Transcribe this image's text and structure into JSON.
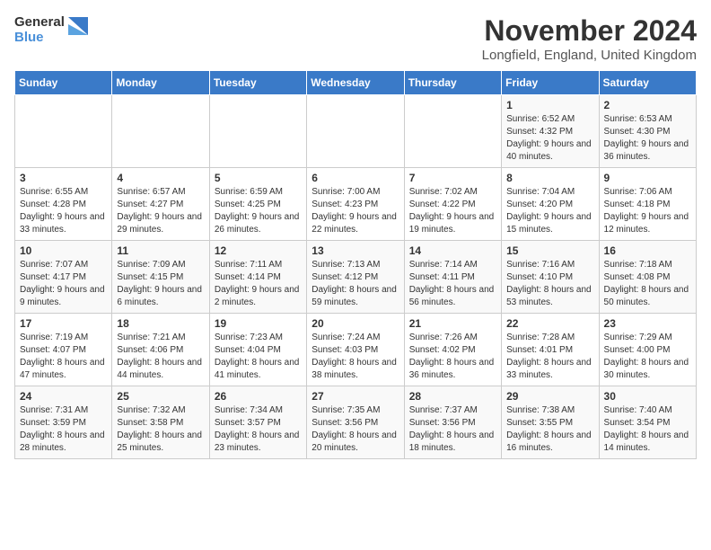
{
  "header": {
    "logo_general": "General",
    "logo_blue": "Blue",
    "month_title": "November 2024",
    "location": "Longfield, England, United Kingdom"
  },
  "days_of_week": [
    "Sunday",
    "Monday",
    "Tuesday",
    "Wednesday",
    "Thursday",
    "Friday",
    "Saturday"
  ],
  "weeks": [
    [
      {
        "day": "",
        "info": ""
      },
      {
        "day": "",
        "info": ""
      },
      {
        "day": "",
        "info": ""
      },
      {
        "day": "",
        "info": ""
      },
      {
        "day": "",
        "info": ""
      },
      {
        "day": "1",
        "info": "Sunrise: 6:52 AM\nSunset: 4:32 PM\nDaylight: 9 hours and 40 minutes."
      },
      {
        "day": "2",
        "info": "Sunrise: 6:53 AM\nSunset: 4:30 PM\nDaylight: 9 hours and 36 minutes."
      }
    ],
    [
      {
        "day": "3",
        "info": "Sunrise: 6:55 AM\nSunset: 4:28 PM\nDaylight: 9 hours and 33 minutes."
      },
      {
        "day": "4",
        "info": "Sunrise: 6:57 AM\nSunset: 4:27 PM\nDaylight: 9 hours and 29 minutes."
      },
      {
        "day": "5",
        "info": "Sunrise: 6:59 AM\nSunset: 4:25 PM\nDaylight: 9 hours and 26 minutes."
      },
      {
        "day": "6",
        "info": "Sunrise: 7:00 AM\nSunset: 4:23 PM\nDaylight: 9 hours and 22 minutes."
      },
      {
        "day": "7",
        "info": "Sunrise: 7:02 AM\nSunset: 4:22 PM\nDaylight: 9 hours and 19 minutes."
      },
      {
        "day": "8",
        "info": "Sunrise: 7:04 AM\nSunset: 4:20 PM\nDaylight: 9 hours and 15 minutes."
      },
      {
        "day": "9",
        "info": "Sunrise: 7:06 AM\nSunset: 4:18 PM\nDaylight: 9 hours and 12 minutes."
      }
    ],
    [
      {
        "day": "10",
        "info": "Sunrise: 7:07 AM\nSunset: 4:17 PM\nDaylight: 9 hours and 9 minutes."
      },
      {
        "day": "11",
        "info": "Sunrise: 7:09 AM\nSunset: 4:15 PM\nDaylight: 9 hours and 6 minutes."
      },
      {
        "day": "12",
        "info": "Sunrise: 7:11 AM\nSunset: 4:14 PM\nDaylight: 9 hours and 2 minutes."
      },
      {
        "day": "13",
        "info": "Sunrise: 7:13 AM\nSunset: 4:12 PM\nDaylight: 8 hours and 59 minutes."
      },
      {
        "day": "14",
        "info": "Sunrise: 7:14 AM\nSunset: 4:11 PM\nDaylight: 8 hours and 56 minutes."
      },
      {
        "day": "15",
        "info": "Sunrise: 7:16 AM\nSunset: 4:10 PM\nDaylight: 8 hours and 53 minutes."
      },
      {
        "day": "16",
        "info": "Sunrise: 7:18 AM\nSunset: 4:08 PM\nDaylight: 8 hours and 50 minutes."
      }
    ],
    [
      {
        "day": "17",
        "info": "Sunrise: 7:19 AM\nSunset: 4:07 PM\nDaylight: 8 hours and 47 minutes."
      },
      {
        "day": "18",
        "info": "Sunrise: 7:21 AM\nSunset: 4:06 PM\nDaylight: 8 hours and 44 minutes."
      },
      {
        "day": "19",
        "info": "Sunrise: 7:23 AM\nSunset: 4:04 PM\nDaylight: 8 hours and 41 minutes."
      },
      {
        "day": "20",
        "info": "Sunrise: 7:24 AM\nSunset: 4:03 PM\nDaylight: 8 hours and 38 minutes."
      },
      {
        "day": "21",
        "info": "Sunrise: 7:26 AM\nSunset: 4:02 PM\nDaylight: 8 hours and 36 minutes."
      },
      {
        "day": "22",
        "info": "Sunrise: 7:28 AM\nSunset: 4:01 PM\nDaylight: 8 hours and 33 minutes."
      },
      {
        "day": "23",
        "info": "Sunrise: 7:29 AM\nSunset: 4:00 PM\nDaylight: 8 hours and 30 minutes."
      }
    ],
    [
      {
        "day": "24",
        "info": "Sunrise: 7:31 AM\nSunset: 3:59 PM\nDaylight: 8 hours and 28 minutes."
      },
      {
        "day": "25",
        "info": "Sunrise: 7:32 AM\nSunset: 3:58 PM\nDaylight: 8 hours and 25 minutes."
      },
      {
        "day": "26",
        "info": "Sunrise: 7:34 AM\nSunset: 3:57 PM\nDaylight: 8 hours and 23 minutes."
      },
      {
        "day": "27",
        "info": "Sunrise: 7:35 AM\nSunset: 3:56 PM\nDaylight: 8 hours and 20 minutes."
      },
      {
        "day": "28",
        "info": "Sunrise: 7:37 AM\nSunset: 3:56 PM\nDaylight: 8 hours and 18 minutes."
      },
      {
        "day": "29",
        "info": "Sunrise: 7:38 AM\nSunset: 3:55 PM\nDaylight: 8 hours and 16 minutes."
      },
      {
        "day": "30",
        "info": "Sunrise: 7:40 AM\nSunset: 3:54 PM\nDaylight: 8 hours and 14 minutes."
      }
    ]
  ]
}
